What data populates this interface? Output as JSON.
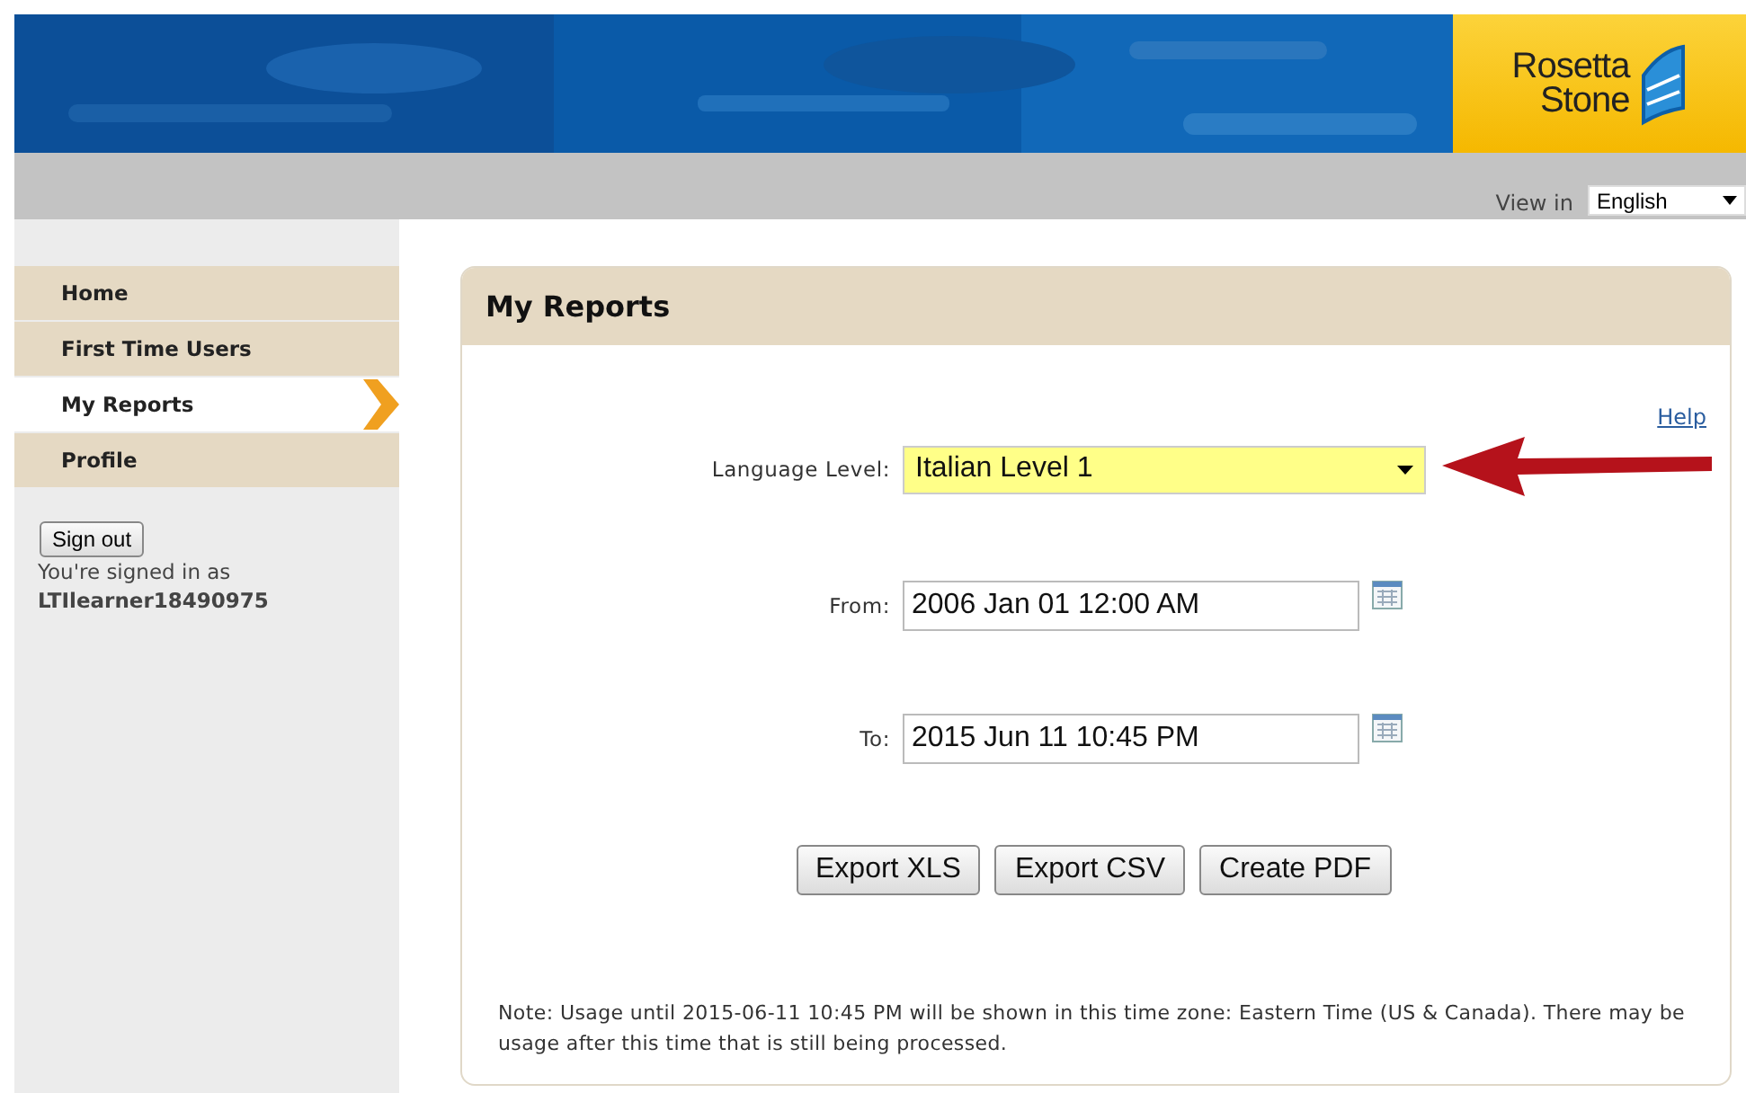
{
  "logo": {
    "line_1": "Rosetta",
    "line_2": "Stone"
  },
  "view_in": {
    "label": "View in",
    "value": "English"
  },
  "sidebar": {
    "items": [
      {
        "label": "Home",
        "selected": false
      },
      {
        "label": "First Time Users",
        "selected": false
      },
      {
        "label": "My Reports",
        "selected": true
      },
      {
        "label": "Profile",
        "selected": false
      }
    ],
    "sign_out": "Sign out",
    "signed_in_text": "You're signed in as",
    "username": "LTIlearner18490975"
  },
  "panel": {
    "title": "My Reports",
    "help": "Help",
    "fields": [
      {
        "kind": "select",
        "label": "Language Level:",
        "value": "Italian Level 1"
      },
      {
        "kind": "date",
        "label": "From:",
        "value": "2006 Jan 01 12:00 AM"
      },
      {
        "kind": "date",
        "label": "To:",
        "value": "2015 Jun 11 10:45 PM"
      }
    ],
    "buttons": [
      "Export XLS",
      "Export CSV",
      "Create PDF"
    ],
    "note": "Note: Usage until 2015-06-11 10:45 PM will be shown in this time zone: Eastern Time (US & Canada). There may be usage after this time that is still being processed."
  }
}
